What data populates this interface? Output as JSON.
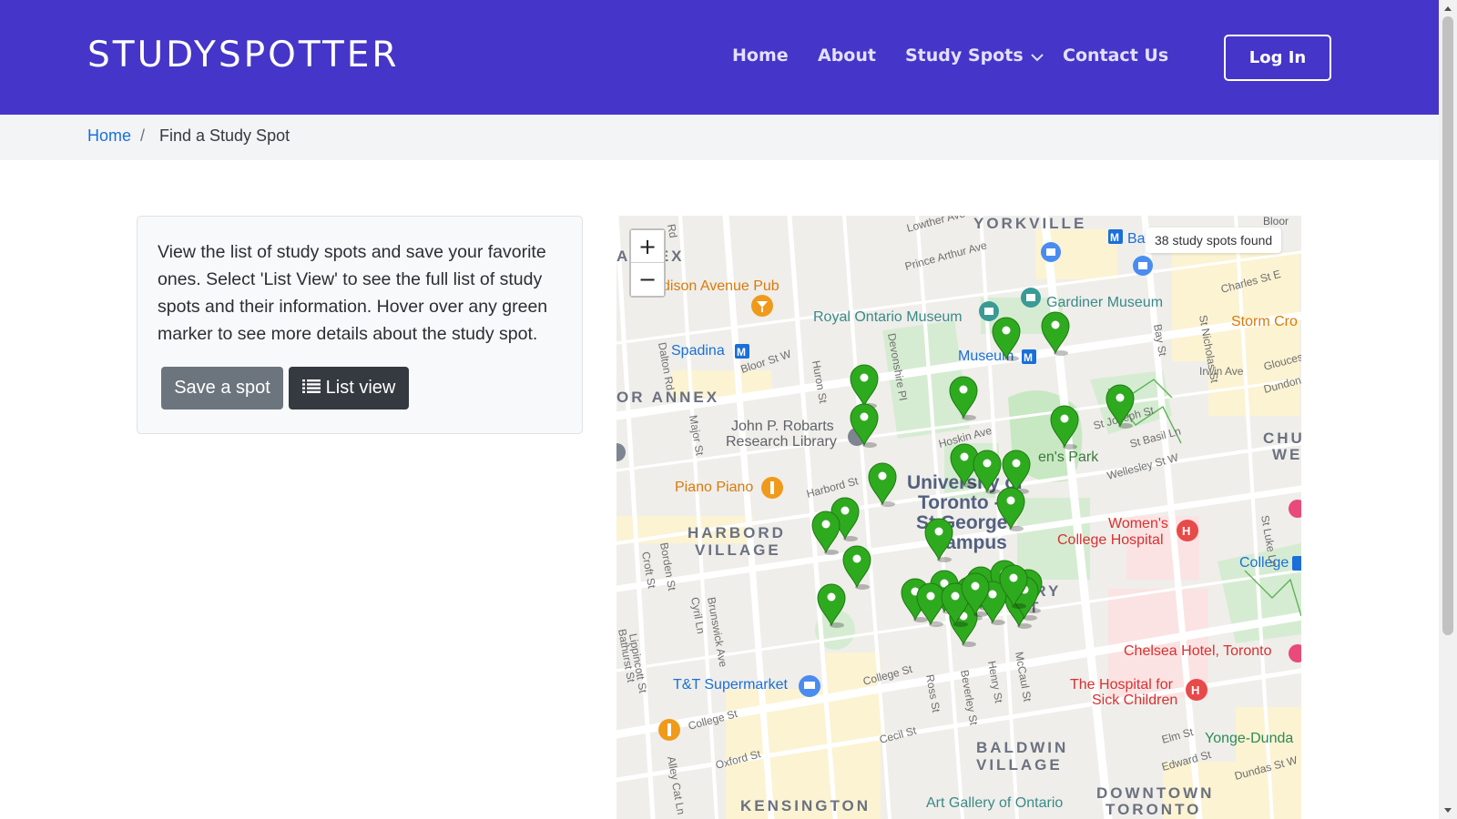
{
  "navbar": {
    "brand": "STUDYSPOTTER",
    "links": [
      {
        "label": "Home"
      },
      {
        "label": "About"
      },
      {
        "label": "Study Spots"
      },
      {
        "label": "Contact Us"
      }
    ],
    "login_label": "Log In",
    "color": "#4535c8"
  },
  "breadcrumb": {
    "home": "Home",
    "separator": "/",
    "current": "Find a Study Spot"
  },
  "card": {
    "text": "View the list of study spots and save your favorite ones. Select 'List View' to see the full list of study spots and their information. Hover over any green marker to see more details about the study spot.",
    "save_button": "Save a spot",
    "list_button": "List view"
  },
  "map": {
    "zoom_in": "+",
    "zoom_out": "−",
    "spots_found": "38 study spots found",
    "marker_color": "#2eaa1e",
    "labels": {
      "yorkville": "YORKVILLE",
      "annex": "ANNEX",
      "annex2": "OR ANNEX",
      "madison": "dison Avenue Pub",
      "rom": "Royal Ontario Museum",
      "gardiner": "Gardiner Museum",
      "storm": "Storm Cro",
      "spadina": "Spadina",
      "museum": "Museum",
      "robarts1": "John P. Robarts",
      "robarts2": "Research Library",
      "queens": "en's Park",
      "uoft1": "University of",
      "uoft2": "Toronto -",
      "uoft3": "St George",
      "uoft4": "Campus",
      "piano": "Piano Piano",
      "harbord1": "HARBORD",
      "harbord2": "VILLAGE",
      "womens1": "Women's",
      "womens2": "College Hospital",
      "college_stn": "College",
      "chelsea": "Chelsea Hotel, Toronto",
      "sickkids1": "The Hospital for",
      "sickkids2": "Sick Children",
      "tt": "T&T Supermarket",
      "yonge": "Yonge-Dunda",
      "baldwin1": "BALDWIN",
      "baldwin2": "VILLAGE",
      "kensington": "KENSINGTON",
      "ago": "Art Gallery of Ontario",
      "downtown1": "DOWNTOWN",
      "downtown2": "TORONTO",
      "church1": "CHU",
      "church2": "WE",
      "bay_stn": "Bay",
      "discovery": "ERY",
      "discovery2": "ICT",
      "bloor_e": "Bloor",
      "bloor_w": "Bloor St W",
      "harbord_st": "Harbord St",
      "college_st": "College St",
      "college_st2": "College St",
      "wellesley": "Wellesley St W",
      "hoskin": "Hoskin Ave",
      "bay_st": "Bay St",
      "huron_st": "Huron St",
      "beverley": "Beverley St",
      "devonshire": "Devonshire Pl",
      "major_st": "Major St",
      "borden_st": "Borden St",
      "croft_st": "Croft St",
      "bathurst": "Bathurst St",
      "brunswick": "Brunswick Ave",
      "lowther": "Lowther Ave",
      "prince_arthur": "Prince Arthur Ave",
      "charles": "Charles St E",
      "st_joseph": "St Joseph St",
      "dundas_w": "Dundas St W",
      "elm": "Elm St",
      "edward": "Edward St",
      "oxford": "Oxford St",
      "cecil": "Cecil St",
      "ross": "Ross St",
      "henry": "Henry St",
      "mccaul": "McCaul St",
      "alley": "Alley Cat Ln",
      "irwin": "Irwin Ave",
      "gloucester": "Gloucester",
      "dundonald": "Dundonal",
      "st_nicholas": "St Nicholas St",
      "st_luke": "St Luke Ln",
      "st_basil": "St Basil Ln",
      "lippincott": "Lippincott St",
      "dalton": "Dalton Rd",
      "cyril": "Cyril Ln",
      "bedford": "Rd"
    }
  }
}
